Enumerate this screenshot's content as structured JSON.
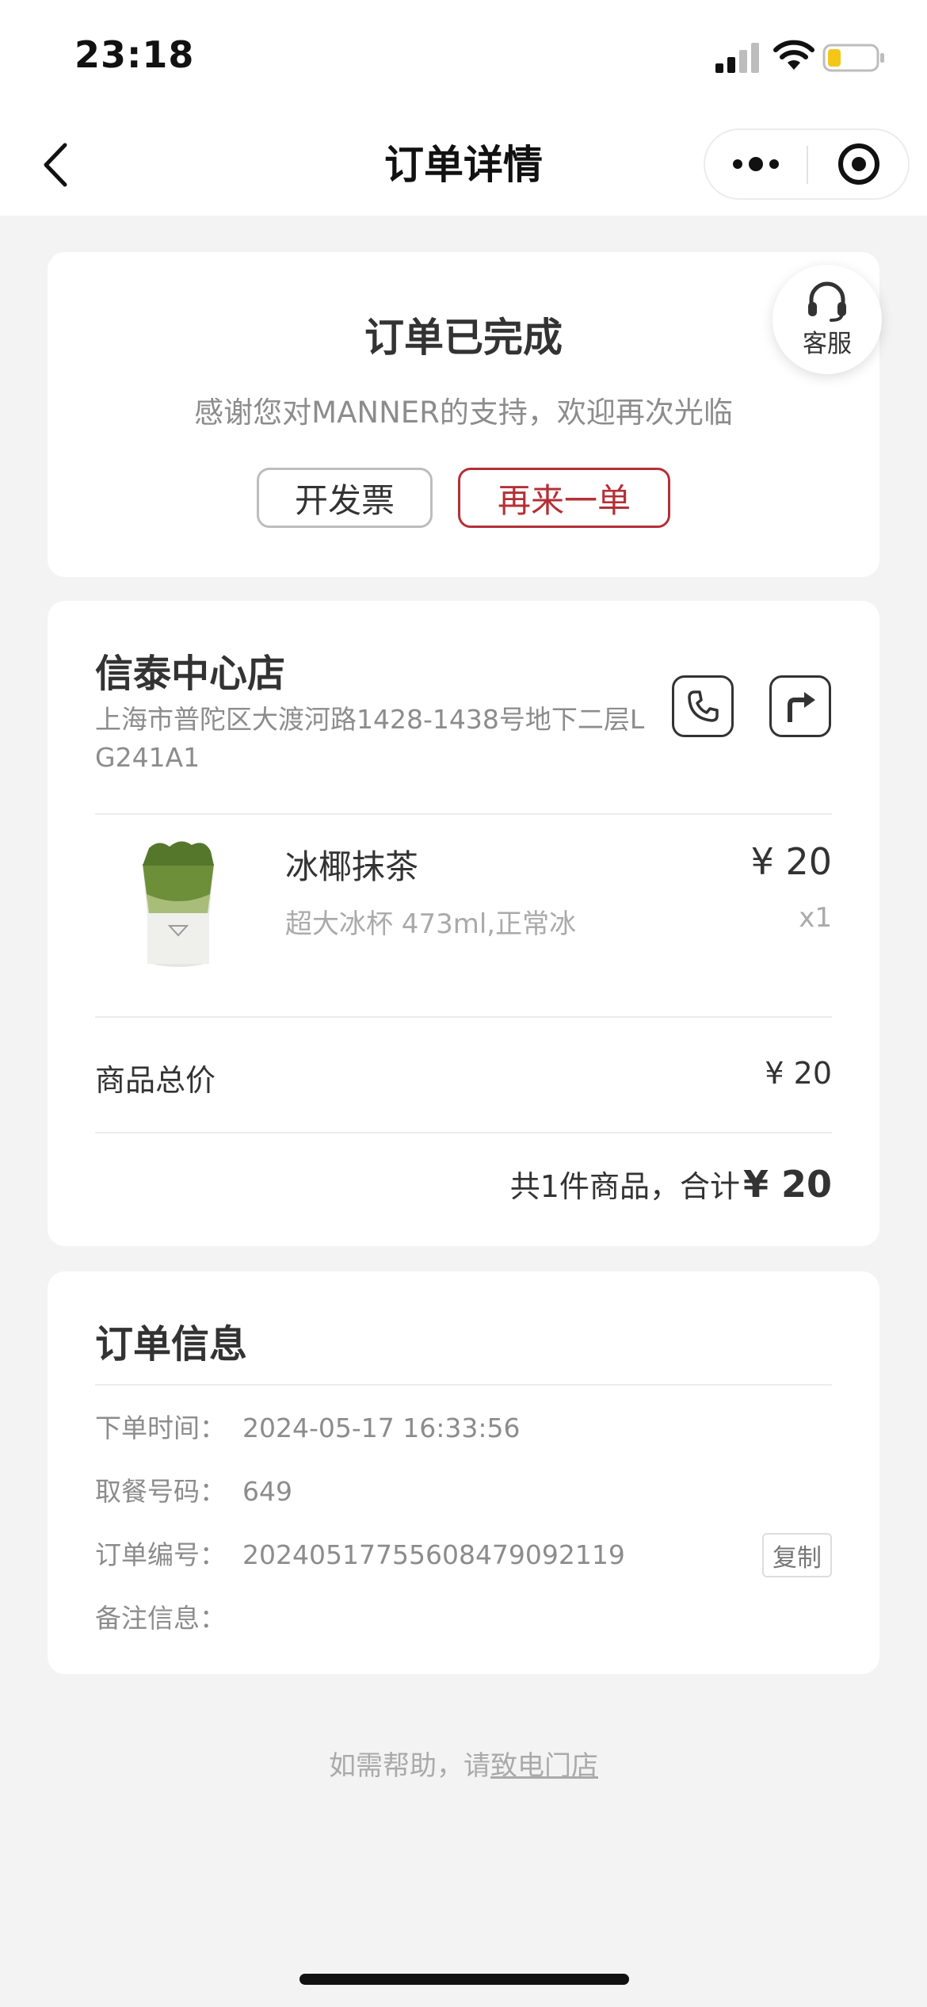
{
  "status_bar": {
    "time": "23:18"
  },
  "nav": {
    "title": "订单详情"
  },
  "order_status": {
    "title": "订单已完成",
    "subtitle": "感谢您对MANNER的支持，欢迎再次光临",
    "invoice_label": "开发票",
    "reorder_label": "再来一单",
    "service_label": "客服"
  },
  "store": {
    "name": "信泰中心店",
    "address": "上海市普陀区大渡河路1428-1438号地下二层LG241A1"
  },
  "items": [
    {
      "name": "冰椰抹茶",
      "spec": "超大冰杯 473ml,正常冰",
      "price": "¥ 20",
      "qty": "x1"
    }
  ],
  "totals": {
    "subtotal_label": "商品总价",
    "subtotal_value": "¥ 20",
    "summary_text": "共1件商品，合计",
    "summary_total": "¥ 20"
  },
  "order_info": {
    "title": "订单信息",
    "rows": [
      {
        "label": "下单时间：",
        "value": "2024-05-17 16:33:56"
      },
      {
        "label": "取餐号码：",
        "value": "649"
      },
      {
        "label": "订单编号：",
        "value": "20240517755608479092119"
      },
      {
        "label": "备注信息：",
        "value": ""
      }
    ],
    "copy_label": "复制"
  },
  "footer": {
    "help_text": "如需帮助，请",
    "help_link": "致电门店"
  },
  "colors": {
    "accent": "#b43036",
    "background": "#f3f3f3",
    "battery_low": "#f5c518"
  }
}
